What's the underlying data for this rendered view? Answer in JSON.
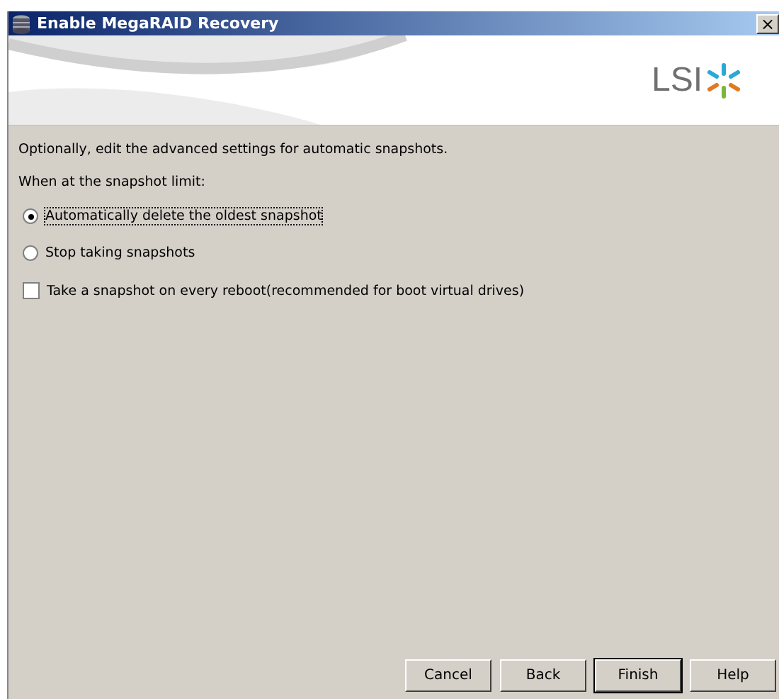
{
  "window": {
    "title": "Enable MegaRAID Recovery",
    "close": "×"
  },
  "header": {
    "logo": "LSI"
  },
  "intro": "Optionally, edit the advanced settings for automatic snapshots.",
  "limit_label": "When at the snapshot limit:",
  "options": [
    {
      "kind": "radio",
      "label": "Automatically delete the oldest snapshot",
      "selected": true
    },
    {
      "kind": "radio",
      "label": "Stop taking snapshots",
      "selected": false
    },
    {
      "kind": "checkbox",
      "label": "Take a snapshot on every reboot(recommended for boot virtual drives)",
      "checked": false
    }
  ],
  "buttons": [
    {
      "label": "Cancel",
      "default": false
    },
    {
      "label": "Back",
      "default": false
    },
    {
      "label": "Finish",
      "default": true
    },
    {
      "label": "Help",
      "default": false
    }
  ]
}
